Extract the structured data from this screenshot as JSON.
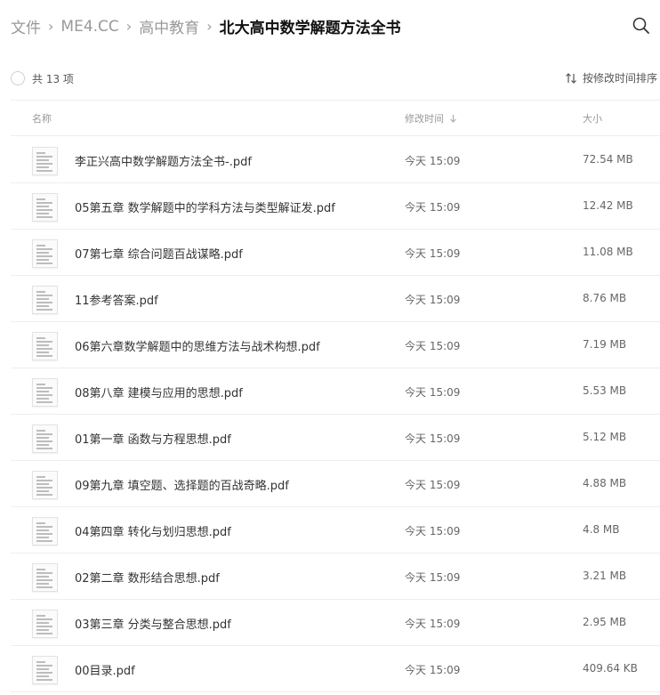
{
  "breadcrumb": {
    "items": [
      "文件",
      "ME4.CC",
      "高中教育",
      "北大高中数学解题方法全书"
    ],
    "separator": "›"
  },
  "toolbar": {
    "search_icon": "search-icon",
    "item_count": "共 13 项",
    "sort_label": "按修改时间排序"
  },
  "columns": {
    "name": "名称",
    "mtime": "修改时间",
    "size": "大小"
  },
  "files": [
    {
      "name": "李正兴高中数学解题方法全书-.pdf",
      "time": "今天 15:09",
      "size": "72.54 MB"
    },
    {
      "name": "05第五章 数学解题中的学科方法与类型解证发.pdf",
      "time": "今天 15:09",
      "size": "12.42 MB"
    },
    {
      "name": "07第七章 综合问题百战谋略.pdf",
      "time": "今天 15:09",
      "size": "11.08 MB"
    },
    {
      "name": "11参考答案.pdf",
      "time": "今天 15:09",
      "size": "8.76 MB"
    },
    {
      "name": "06第六章数学解题中的思维方法与战术构想.pdf",
      "time": "今天 15:09",
      "size": "7.19 MB"
    },
    {
      "name": "08第八章 建模与应用的思想.pdf",
      "time": "今天 15:09",
      "size": "5.53 MB"
    },
    {
      "name": "01第一章 函数与方程思想.pdf",
      "time": "今天 15:09",
      "size": "5.12 MB"
    },
    {
      "name": "09第九章 填空题、选择题的百战奇略.pdf",
      "time": "今天 15:09",
      "size": "4.88 MB"
    },
    {
      "name": "04第四章 转化与划归思想.pdf",
      "time": "今天 15:09",
      "size": "4.8 MB"
    },
    {
      "name": "02第二章 数形结合思想.pdf",
      "time": "今天 15:09",
      "size": "3.21 MB"
    },
    {
      "name": "03第三章 分类与整合思想.pdf",
      "time": "今天 15:09",
      "size": "2.95 MB"
    },
    {
      "name": "00目录.pdf",
      "time": "今天 15:09",
      "size": "409.64 KB"
    }
  ]
}
